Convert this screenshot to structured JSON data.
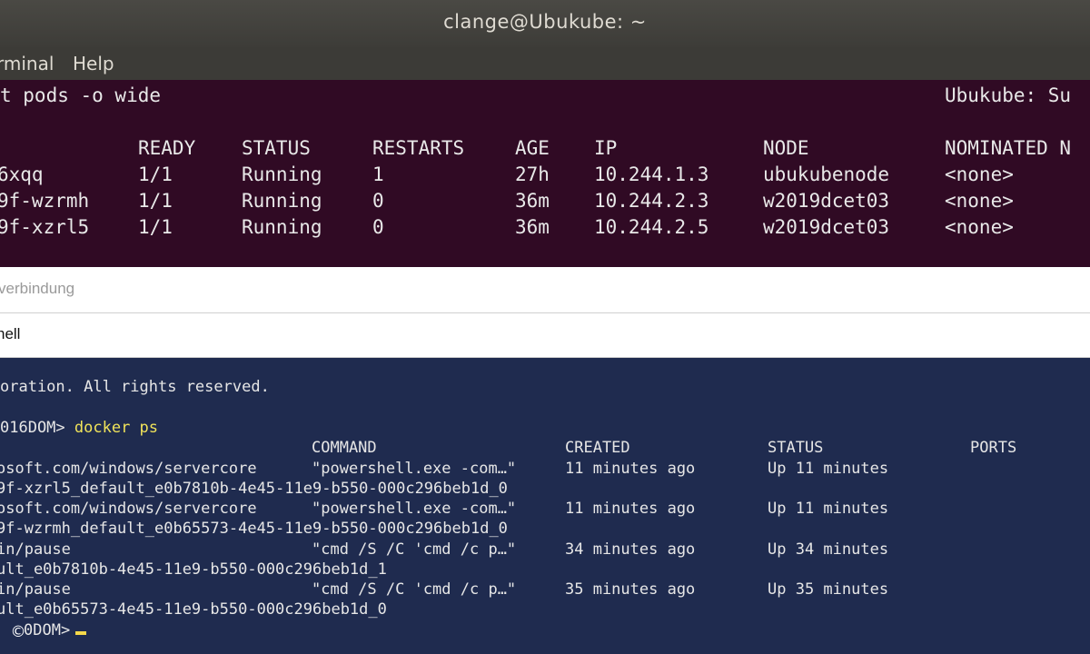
{
  "window": {
    "title": "clange@Ubukube: ~"
  },
  "menu": {
    "items": [
      "rminal",
      "Help"
    ]
  },
  "ubuntu_terminal": {
    "command": "t pods -o wide",
    "host_label": "Ubukube: Su",
    "headers": [
      "READY",
      "STATUS",
      "RESTARTS",
      "AGE",
      "IP",
      "NODE",
      "NOMINATED N"
    ],
    "rows": [
      [
        "6xqq",
        "1/1",
        "Running",
        "1",
        "27h",
        "10.244.1.3",
        "ubukubenode",
        "<none>"
      ],
      [
        "9f-wzrmh",
        "1/1",
        "Running",
        "0",
        "36m",
        "10.244.2.3",
        "w2019dcet03",
        "<none>"
      ],
      [
        "9f-xzrl5",
        "1/1",
        "Running",
        "0",
        "36m",
        "10.244.2.5",
        "w2019dcet03",
        "<none>"
      ]
    ]
  },
  "rdp": {
    "label": "verbindung"
  },
  "powershell": {
    "title": "hell",
    "copyright_line": "oration. All rights reserved.",
    "prompt": "016DOM>",
    "command": "docker ps",
    "headers": {
      "command": "COMMAND",
      "created": "CREATED",
      "status": "STATUS",
      "ports": "PORTS"
    },
    "rows": [
      {
        "image": "osoft.com/windows/servercore",
        "command": "\"powershell.exe -com…\"",
        "created": "11 minutes ago",
        "status": "Up 11 minutes",
        "name": "9f-xzrl5_default_e0b7810b-4e45-11e9-b550-000c296beb1d_0"
      },
      {
        "image": "osoft.com/windows/servercore",
        "command": "\"powershell.exe -com…\"",
        "created": "11 minutes ago",
        "status": "Up 11 minutes",
        "name": "9f-wzrmh_default_e0b65573-4e45-11e9-b550-000c296beb1d_0"
      },
      {
        "image": "in/pause",
        "command": "\"cmd /S /C 'cmd /c p…\"",
        "created": "34 minutes ago",
        "status": "Up 34 minutes",
        "name": "ult_e0b7810b-4e45-11e9-b550-000c296beb1d_1"
      },
      {
        "image": "in/pause",
        "command": "\"cmd /S /C 'cmd /c p…\"",
        "created": "35 minutes ago",
        "status": "Up 35 minutes",
        "name": "ult_e0b65573-4e45-11e9-b550-000c296beb1d_0"
      }
    ],
    "final_prompt": "0DOM>"
  },
  "watermark": "©"
}
